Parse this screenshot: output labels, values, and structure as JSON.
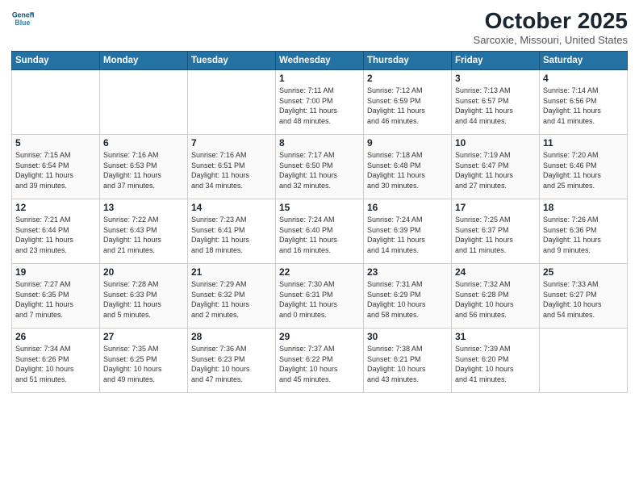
{
  "logo": {
    "line1": "General",
    "line2": "Blue"
  },
  "title": "October 2025",
  "subtitle": "Sarcoxie, Missouri, United States",
  "weekdays": [
    "Sunday",
    "Monday",
    "Tuesday",
    "Wednesday",
    "Thursday",
    "Friday",
    "Saturday"
  ],
  "weeks": [
    [
      {
        "day": "",
        "info": ""
      },
      {
        "day": "",
        "info": ""
      },
      {
        "day": "",
        "info": ""
      },
      {
        "day": "1",
        "info": "Sunrise: 7:11 AM\nSunset: 7:00 PM\nDaylight: 11 hours\nand 48 minutes."
      },
      {
        "day": "2",
        "info": "Sunrise: 7:12 AM\nSunset: 6:59 PM\nDaylight: 11 hours\nand 46 minutes."
      },
      {
        "day": "3",
        "info": "Sunrise: 7:13 AM\nSunset: 6:57 PM\nDaylight: 11 hours\nand 44 minutes."
      },
      {
        "day": "4",
        "info": "Sunrise: 7:14 AM\nSunset: 6:56 PM\nDaylight: 11 hours\nand 41 minutes."
      }
    ],
    [
      {
        "day": "5",
        "info": "Sunrise: 7:15 AM\nSunset: 6:54 PM\nDaylight: 11 hours\nand 39 minutes."
      },
      {
        "day": "6",
        "info": "Sunrise: 7:16 AM\nSunset: 6:53 PM\nDaylight: 11 hours\nand 37 minutes."
      },
      {
        "day": "7",
        "info": "Sunrise: 7:16 AM\nSunset: 6:51 PM\nDaylight: 11 hours\nand 34 minutes."
      },
      {
        "day": "8",
        "info": "Sunrise: 7:17 AM\nSunset: 6:50 PM\nDaylight: 11 hours\nand 32 minutes."
      },
      {
        "day": "9",
        "info": "Sunrise: 7:18 AM\nSunset: 6:48 PM\nDaylight: 11 hours\nand 30 minutes."
      },
      {
        "day": "10",
        "info": "Sunrise: 7:19 AM\nSunset: 6:47 PM\nDaylight: 11 hours\nand 27 minutes."
      },
      {
        "day": "11",
        "info": "Sunrise: 7:20 AM\nSunset: 6:46 PM\nDaylight: 11 hours\nand 25 minutes."
      }
    ],
    [
      {
        "day": "12",
        "info": "Sunrise: 7:21 AM\nSunset: 6:44 PM\nDaylight: 11 hours\nand 23 minutes."
      },
      {
        "day": "13",
        "info": "Sunrise: 7:22 AM\nSunset: 6:43 PM\nDaylight: 11 hours\nand 21 minutes."
      },
      {
        "day": "14",
        "info": "Sunrise: 7:23 AM\nSunset: 6:41 PM\nDaylight: 11 hours\nand 18 minutes."
      },
      {
        "day": "15",
        "info": "Sunrise: 7:24 AM\nSunset: 6:40 PM\nDaylight: 11 hours\nand 16 minutes."
      },
      {
        "day": "16",
        "info": "Sunrise: 7:24 AM\nSunset: 6:39 PM\nDaylight: 11 hours\nand 14 minutes."
      },
      {
        "day": "17",
        "info": "Sunrise: 7:25 AM\nSunset: 6:37 PM\nDaylight: 11 hours\nand 11 minutes."
      },
      {
        "day": "18",
        "info": "Sunrise: 7:26 AM\nSunset: 6:36 PM\nDaylight: 11 hours\nand 9 minutes."
      }
    ],
    [
      {
        "day": "19",
        "info": "Sunrise: 7:27 AM\nSunset: 6:35 PM\nDaylight: 11 hours\nand 7 minutes."
      },
      {
        "day": "20",
        "info": "Sunrise: 7:28 AM\nSunset: 6:33 PM\nDaylight: 11 hours\nand 5 minutes."
      },
      {
        "day": "21",
        "info": "Sunrise: 7:29 AM\nSunset: 6:32 PM\nDaylight: 11 hours\nand 2 minutes."
      },
      {
        "day": "22",
        "info": "Sunrise: 7:30 AM\nSunset: 6:31 PM\nDaylight: 11 hours\nand 0 minutes."
      },
      {
        "day": "23",
        "info": "Sunrise: 7:31 AM\nSunset: 6:29 PM\nDaylight: 10 hours\nand 58 minutes."
      },
      {
        "day": "24",
        "info": "Sunrise: 7:32 AM\nSunset: 6:28 PM\nDaylight: 10 hours\nand 56 minutes."
      },
      {
        "day": "25",
        "info": "Sunrise: 7:33 AM\nSunset: 6:27 PM\nDaylight: 10 hours\nand 54 minutes."
      }
    ],
    [
      {
        "day": "26",
        "info": "Sunrise: 7:34 AM\nSunset: 6:26 PM\nDaylight: 10 hours\nand 51 minutes."
      },
      {
        "day": "27",
        "info": "Sunrise: 7:35 AM\nSunset: 6:25 PM\nDaylight: 10 hours\nand 49 minutes."
      },
      {
        "day": "28",
        "info": "Sunrise: 7:36 AM\nSunset: 6:23 PM\nDaylight: 10 hours\nand 47 minutes."
      },
      {
        "day": "29",
        "info": "Sunrise: 7:37 AM\nSunset: 6:22 PM\nDaylight: 10 hours\nand 45 minutes."
      },
      {
        "day": "30",
        "info": "Sunrise: 7:38 AM\nSunset: 6:21 PM\nDaylight: 10 hours\nand 43 minutes."
      },
      {
        "day": "31",
        "info": "Sunrise: 7:39 AM\nSunset: 6:20 PM\nDaylight: 10 hours\nand 41 minutes."
      },
      {
        "day": "",
        "info": ""
      }
    ]
  ]
}
